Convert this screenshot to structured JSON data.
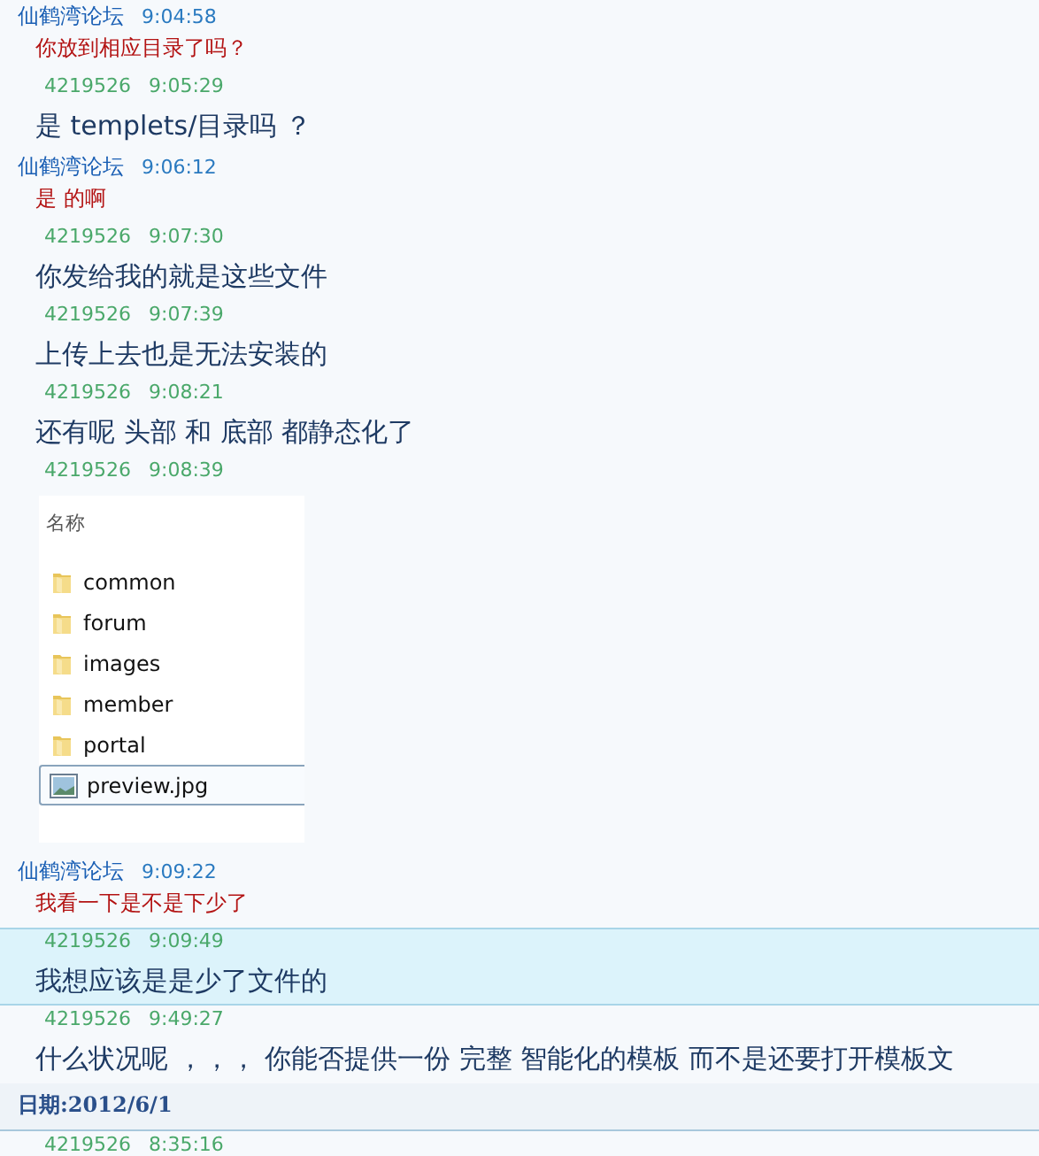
{
  "messages": [
    {
      "kind": "incoming",
      "sender": "仙鹤湾论坛",
      "time": "9:04:58",
      "text": "你放到相应目录了吗？",
      "selected": false
    },
    {
      "kind": "outgoing",
      "sender": "4219526",
      "time": "9:05:29",
      "text": "是  templets/目录吗  ？",
      "selected": false
    },
    {
      "kind": "incoming",
      "sender": "仙鹤湾论坛",
      "time": "9:06:12",
      "text": "是  的啊",
      "selected": false
    },
    {
      "kind": "outgoing",
      "sender": "4219526",
      "time": "9:07:30",
      "text": "你发给我的就是这些文件",
      "selected": false
    },
    {
      "kind": "outgoing",
      "sender": "4219526",
      "time": "9:07:39",
      "text": "上传上去也是无法安装的",
      "selected": false
    },
    {
      "kind": "outgoing",
      "sender": "4219526",
      "time": "9:08:21",
      "text": "还有呢  头部  和 底部  都静态化了",
      "selected": false
    },
    {
      "kind": "outgoing",
      "sender": "4219526",
      "time": "9:08:39",
      "selected": false,
      "attachment": {
        "header": "名称",
        "files": [
          {
            "kind": "folder",
            "name": "common",
            "selected": false
          },
          {
            "kind": "folder",
            "name": "forum",
            "selected": false
          },
          {
            "kind": "folder",
            "name": "images",
            "selected": false
          },
          {
            "kind": "folder",
            "name": "member",
            "selected": false
          },
          {
            "kind": "folder",
            "name": "portal",
            "selected": false
          },
          {
            "kind": "image",
            "name": "preview.jpg",
            "selected": true
          }
        ]
      }
    },
    {
      "kind": "incoming",
      "sender": "仙鹤湾论坛",
      "time": "9:09:22",
      "text": "我看一下是不是下少了",
      "selected": false
    },
    {
      "kind": "outgoing",
      "sender": "4219526",
      "time": "9:09:49",
      "text": "我想应该是是少了文件的",
      "selected": true
    },
    {
      "kind": "outgoing",
      "sender": "4219526",
      "time": "9:49:27",
      "text": "什么状况呢  ，，，  你能否提供一份 完整  智能化的模板  而不是还要打开模板文",
      "selected": false
    },
    {
      "kind": "date",
      "text": "日期:2012/6/1"
    },
    {
      "kind": "outgoing",
      "sender": "4219526",
      "time": "8:35:16",
      "selected": false
    }
  ]
}
